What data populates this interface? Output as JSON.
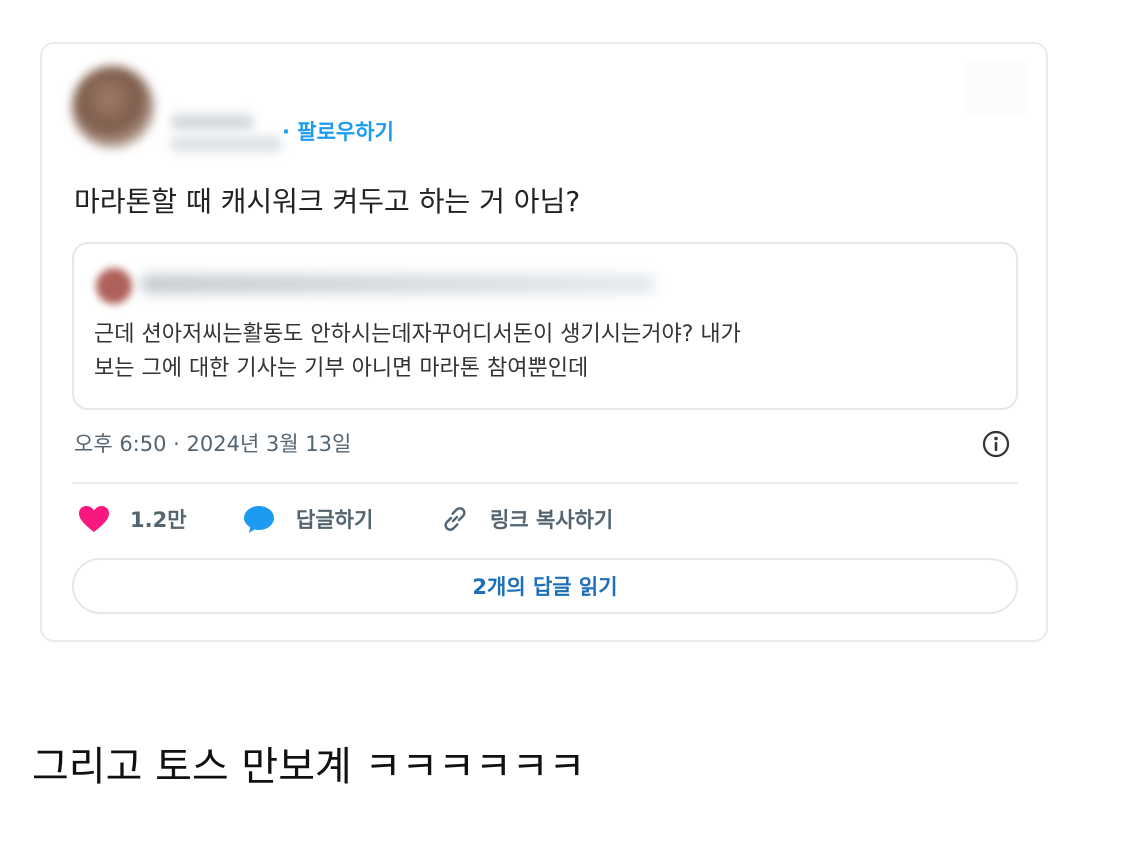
{
  "tweet": {
    "follow_label": "· 팔로우하기",
    "text": "마라톤할 때 캐시워크 켜두고 하는 거 아님?",
    "quoted": {
      "text_line1": "근데 션아저씨는활동도 안하시는데자꾸어디서돈이 생기시는거야? 내가",
      "text_line2": "보는 그에 대한 기사는 기부 아니면 마라톤 참여뿐인데"
    },
    "timestamp": "오후 6:50 · 2024년 3월 13일",
    "actions": {
      "like_count": "1.2만",
      "reply_label": "답글하기",
      "copy_link_label": "링크 복사하기"
    },
    "read_replies_label": "2개의 답글 읽기"
  },
  "caption": "그리고 토스 만보계 ㅋㅋㅋㅋㅋㅋ",
  "colors": {
    "heart": "#f91880",
    "reply_bubble": "#1d9bf0",
    "follow_link": "#1d9bf0",
    "read_replies_text": "#1d6fb8",
    "secondary_text": "#536471"
  },
  "icons": {
    "like": "heart-icon",
    "reply": "speech-bubble-icon",
    "copy": "link-icon",
    "info": "info-icon"
  }
}
